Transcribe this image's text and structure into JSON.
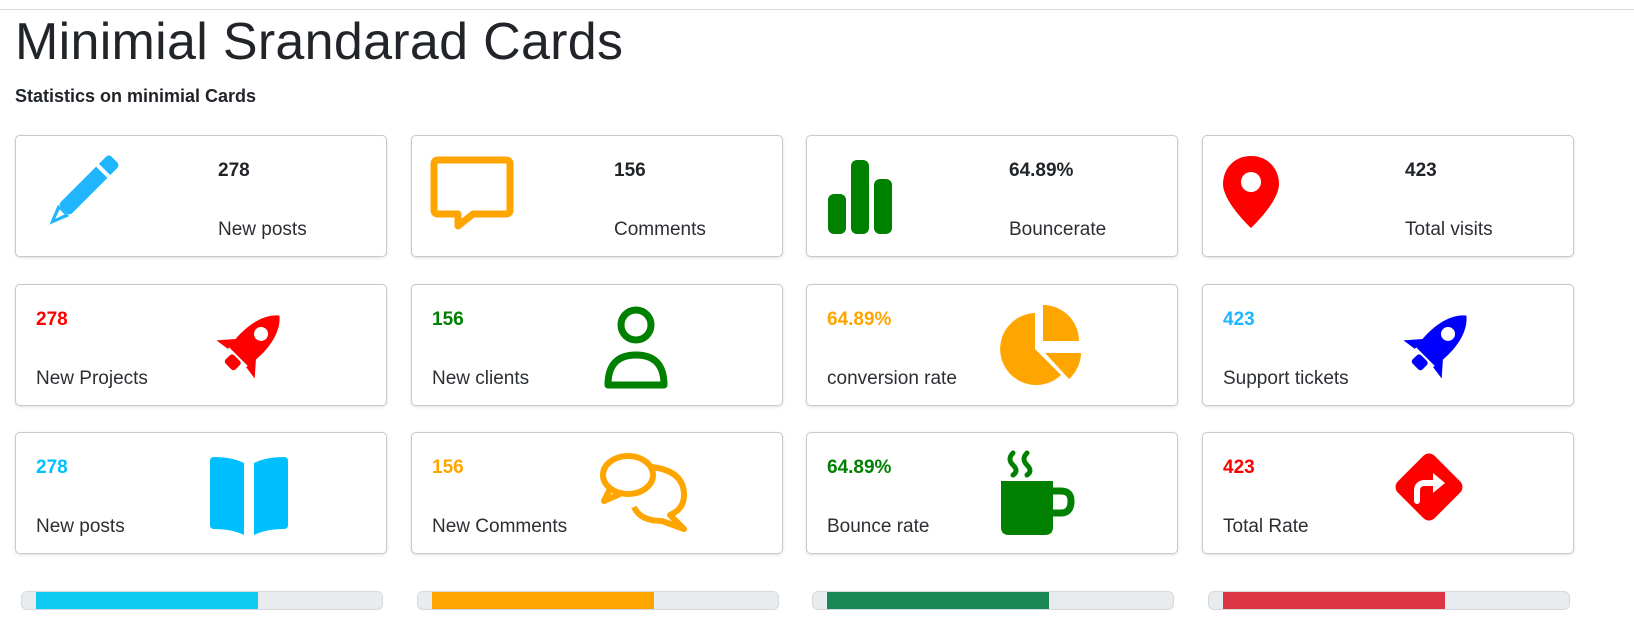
{
  "page": {
    "title": "Minimial Srandarad Cards",
    "subtitle": "Statistics on minimial Cards"
  },
  "rows": [
    [
      {
        "value": "278",
        "label": "New posts",
        "icon": "pencil-icon",
        "color": "#1fb6ff"
      },
      {
        "value": "156",
        "label": "Comments",
        "icon": "speech-bubble-icon",
        "color": "#ffa500"
      },
      {
        "value": "64.89%",
        "label": "Bouncerate",
        "icon": "bar-chart-icon",
        "color": "#008000"
      },
      {
        "value": "423",
        "label": "Total visits",
        "icon": "map-pin-icon",
        "color": "#ff0000"
      }
    ],
    [
      {
        "value": "278",
        "label": "New Projects",
        "icon": "rocket-icon",
        "color": "#ff0000"
      },
      {
        "value": "156",
        "label": "New clients",
        "icon": "user-icon",
        "color": "#008000"
      },
      {
        "value": "64.89%",
        "label": "conversion rate",
        "icon": "pie-chart-icon",
        "color": "#ffa500"
      },
      {
        "value": "423",
        "label": "Support tickets",
        "icon": "rocket-icon",
        "color": "#0000ff"
      }
    ],
    [
      {
        "value": "278",
        "label": "New posts",
        "icon": "book-icon",
        "color": "#00bfff"
      },
      {
        "value": "156",
        "label": "New Comments",
        "icon": "comments-icon",
        "color": "#ffa500"
      },
      {
        "value": "64.89%",
        "label": "Bounce rate",
        "icon": "coffee-cup-icon",
        "color": "#008000"
      },
      {
        "value": "423",
        "label": "Total Rate",
        "icon": "directions-sign-icon",
        "color": "#ff0000"
      }
    ]
  ],
  "progress": [
    {
      "percent": 65,
      "color": "#0dcaf0"
    },
    {
      "percent": 65,
      "color": "#ffa500"
    },
    {
      "percent": 65,
      "color": "#198754"
    },
    {
      "percent": 65,
      "color": "#dc3545"
    }
  ],
  "colors": {
    "value_row1": "#212529",
    "title": "#212529"
  }
}
